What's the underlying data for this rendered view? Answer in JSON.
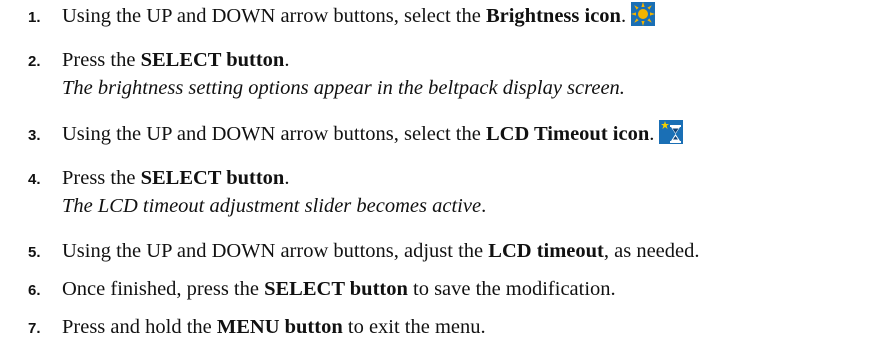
{
  "steps": [
    {
      "number": "1.",
      "pre": "Using the UP and DOWN arrow buttons, select the ",
      "bold": "Brightness icon",
      "post": ".",
      "icon": "brightness-sun-icon"
    },
    {
      "number": "2.",
      "pre": "Press the ",
      "bold": "SELECT button",
      "post": ".",
      "note": "The brightness setting options appear in the beltpack display screen."
    },
    {
      "number": "3.",
      "pre": "Using the UP and DOWN arrow buttons, select the ",
      "bold": "LCD Timeout icon",
      "post": ".",
      "icon": "lcd-timeout-hourglass-icon"
    },
    {
      "number": "4.",
      "pre": "Press the ",
      "bold": "SELECT button",
      "post": ".",
      "note": "The LCD timeout adjustment slider becomes active",
      "note_post": "."
    },
    {
      "number": "5.",
      "pre": "Using the UP and DOWN arrow buttons, adjust the ",
      "bold": "LCD timeout",
      "post": ", as needed."
    },
    {
      "number": "6.",
      "pre": "Once finished, press the ",
      "bold": "SELECT button",
      "post": " to save the modification."
    },
    {
      "number": "7.",
      "pre": "Press and hold the ",
      "bold": "MENU button",
      "post": " to exit the menu."
    }
  ],
  "colors": {
    "sun": "#f4b400",
    "icon_blue": "#1a6fb5",
    "icon_dark_blue": "#0d3f73"
  }
}
